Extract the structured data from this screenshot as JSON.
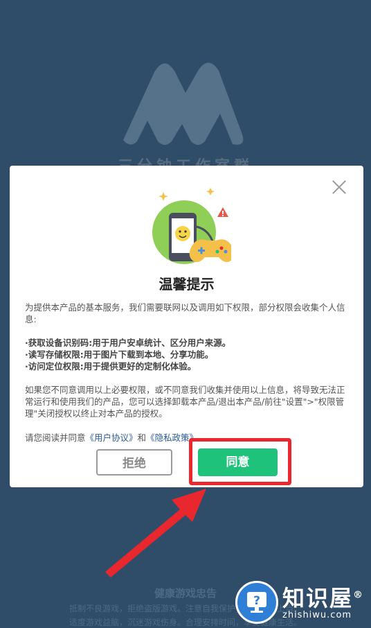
{
  "background": {
    "app_name": "三分钟工作室群",
    "notice_title": "健康游戏忠告",
    "notice_lines": [
      "抵制不良游戏，拒绝盗版游戏。注意自我保护，谨防受骗上当。",
      "适度游戏益脑，沉迷游戏伤身。合理安排时间，享受健康生活。"
    ]
  },
  "dialog": {
    "title": "温馨提示",
    "intro": "为提供本产品的基本服务，我们需要联网以及调用如下权限，部分权限会收集个人信息:",
    "permissions": [
      "·获取设备识别码:用于用户安卓统计、区分用户来源。",
      "·读写存储权限:用于图片下载到本地、分享功能。",
      "·访问定位权限:用于提供更好的定制化体验。"
    ],
    "disclaimer": "如果您不同意调用以上必要权限，或不同意我们收集并使用以上信息，将导致无法正常运行和使用我们的产品，您可以选择卸载本产品/退出本产品/前往\"设置\">\"权限管理\"关闭授权以终止对本产品的授权。",
    "agree_prefix": "请您阅读并同意",
    "user_agreement": "《用户协议》",
    "and_text": "和",
    "privacy_policy": "《隐私政策》",
    "agree_suffix": "。",
    "reject_label": "拒绝",
    "accept_label": "同意"
  },
  "watermark": {
    "name": "知识屋",
    "url": "zhishiwu.com",
    "registered": "®",
    "icon": "question-monitor-icon"
  },
  "colors": {
    "background": "#2f4d68",
    "accept": "#1fc27a",
    "highlight": "#e8282e",
    "link": "#2a5b9a"
  }
}
